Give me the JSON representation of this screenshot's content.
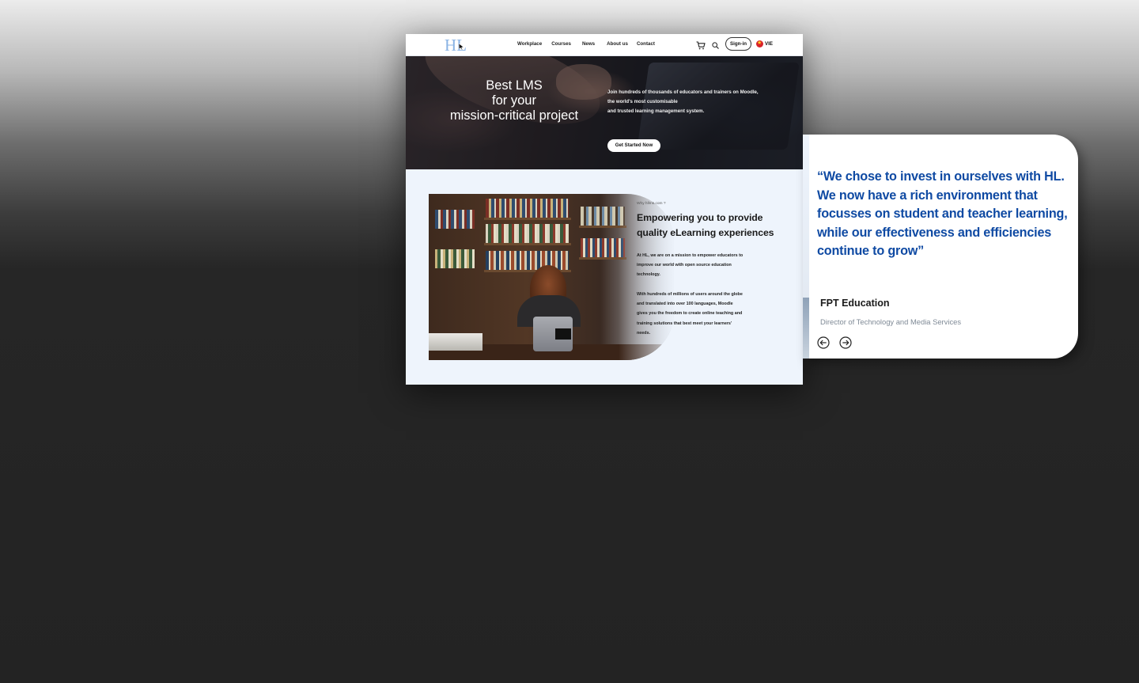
{
  "navbar": {
    "logo_text": "HL",
    "links": [
      "Workplace",
      "Courses",
      "News",
      "About us",
      "Contact"
    ],
    "signin_label": "Sign-in",
    "language": "VIE",
    "icons": [
      "cart-icon",
      "search-icon",
      "vietnam-flag-icon"
    ]
  },
  "hero": {
    "title_lines": [
      "Best LMS",
      "for your",
      "mission-critical project"
    ],
    "description_lines": [
      "Join hundreds of thousands of educators and trainers on Moodle,",
      "the world's most customisable",
      "and trusted learning management system."
    ],
    "cta_label": "Get Started Now"
  },
  "about": {
    "label": "Why hllms.com ?",
    "title_lines": [
      "Empowering you to provide",
      "quality eLearning experiences"
    ],
    "paragraph1_lines": [
      "At HL, we are on a mission to empower educators to",
      "improve our world with open source education",
      "technology."
    ],
    "paragraph2_lines": [
      "With hundreds of millions of users around the globe",
      "and translated into over 100 languages, Moodle",
      "gives you the freedom to create online teaching and",
      "training solutions that best meet your learners'",
      "needs."
    ]
  },
  "testimonial": {
    "quote_lines": [
      "“We chose to invest in ourselves with HL.",
      "We now have a rich environment that",
      "focusses on student and teacher learning,",
      "while our effectiveness and efficiencies",
      "continue to grow”"
    ],
    "author": "FPT Education",
    "role": "Director of Technology and Media Services",
    "icons": [
      "arrow-left-circle-icon",
      "arrow-right-circle-icon"
    ]
  },
  "colors": {
    "quote_blue": "#0f4aa3",
    "page_light_blue": "#eef4fc",
    "logo_blue": "#8ab3e4",
    "flag_red": "#d8222a"
  }
}
